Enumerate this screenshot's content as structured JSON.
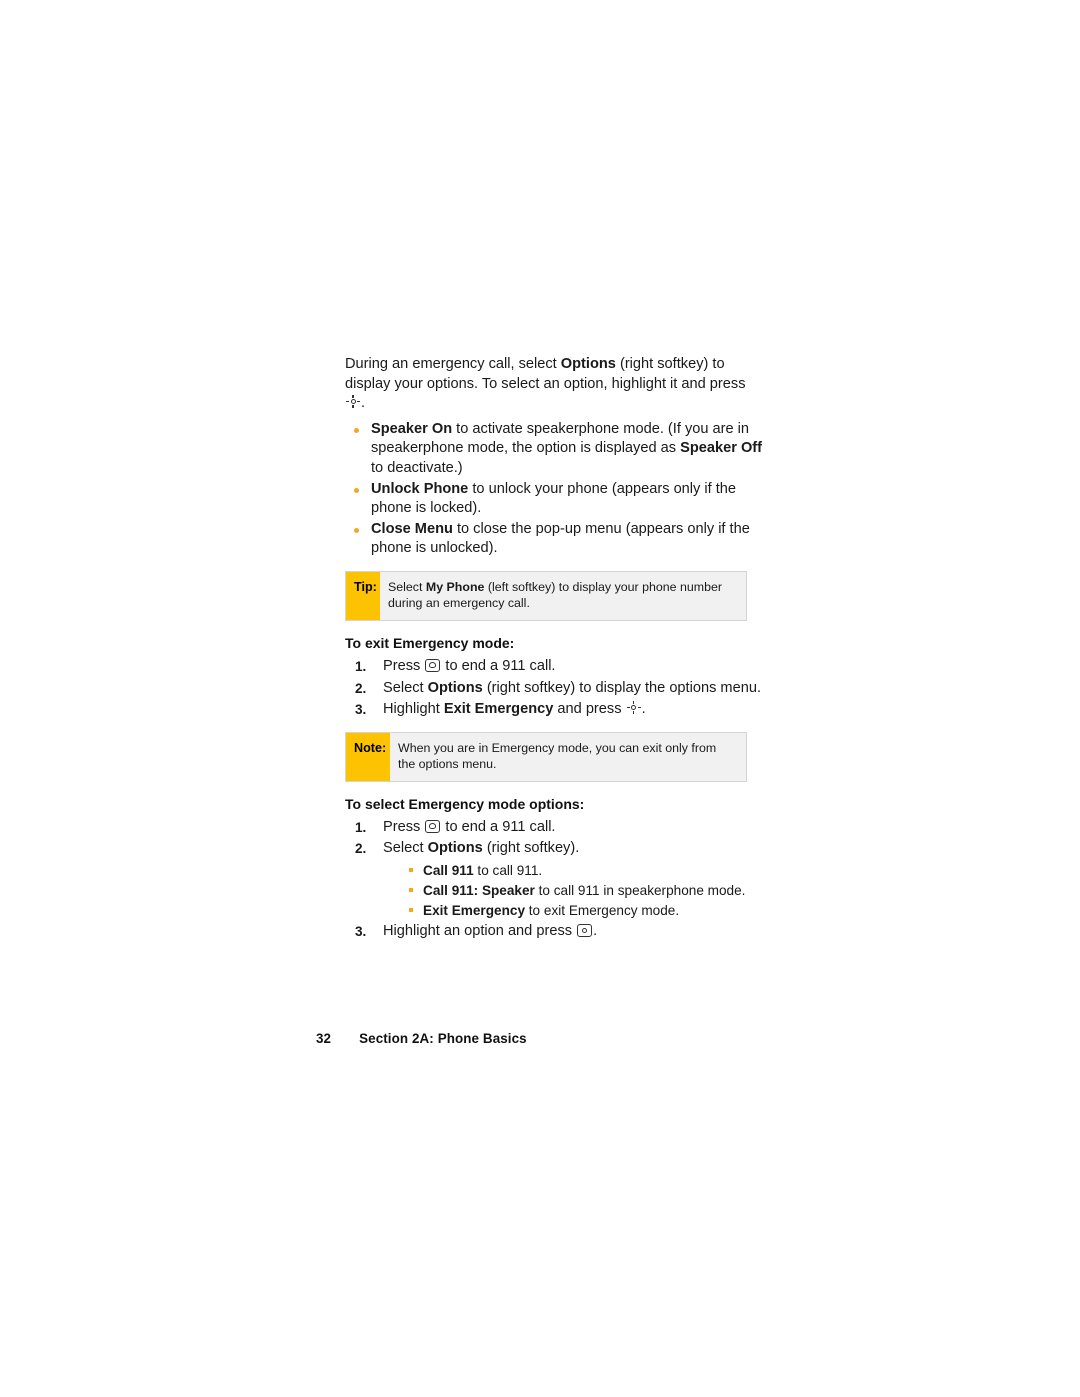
{
  "intro": {
    "line1_a": "During an emergency call, select ",
    "line1_b": "Options",
    "line1_c": " (right softkey) to display your options. To select an option, highlight it and press ",
    "line1_d": "."
  },
  "options_bullets": [
    {
      "bold1": "Speaker On",
      "text1": " to activate speakerphone mode. (If you are in speakerphone mode, the option is displayed as ",
      "bold2": "Speaker Off",
      "text2": " to deactivate.)"
    },
    {
      "bold1": "Unlock Phone",
      "text1": " to unlock your phone (appears only if the phone is locked).",
      "bold2": "",
      "text2": ""
    },
    {
      "bold1": "Close Menu",
      "text1": " to close the pop-up menu (appears only if the phone is unlocked).",
      "bold2": "",
      "text2": ""
    }
  ],
  "tip_callout": {
    "label": "Tip:",
    "text_a": "Select ",
    "text_b": "My Phone",
    "text_c": " (left softkey) to display your phone number during an emergency call."
  },
  "exit_section": {
    "heading": "To exit Emergency mode:",
    "steps": [
      {
        "num": "1.",
        "a": "Press ",
        "icon": "end-key-icon",
        "b": " to end a 911 call.",
        "bold": "",
        "c": ""
      },
      {
        "num": "2.",
        "a": "Select ",
        "icon": "",
        "bold": "Options",
        "b": " (right softkey) to display the options menu.",
        "c": ""
      },
      {
        "num": "3.",
        "a": "Highlight ",
        "icon": "nav-key-icon",
        "bold": "Exit Emergency",
        "b": " and press ",
        "c": "."
      }
    ]
  },
  "note_callout": {
    "label": "Note:",
    "text": "When you are in Emergency mode, you can exit only from the options menu."
  },
  "select_section": {
    "heading": "To select Emergency mode options:",
    "steps": [
      {
        "num": "1.",
        "a": "Press ",
        "icon": "end-key-icon",
        "b": " to end a 911 call."
      },
      {
        "num": "2.",
        "a": "Select ",
        "bold": "Options",
        "b": " (right softkey)."
      },
      {
        "num": "3.",
        "a": "Highlight an option and press ",
        "icon": "ok-key-icon",
        "b": "."
      }
    ],
    "sub_bullets": [
      {
        "bold": "Call 911",
        "text": " to call 911."
      },
      {
        "bold": "Call 911: Speaker",
        "text": " to call 911 in speakerphone mode."
      },
      {
        "bold": "Exit Emergency",
        "text": " to exit Emergency mode."
      }
    ]
  },
  "footer": {
    "page_number": "32",
    "section_title": "Section 2A: Phone Basics"
  },
  "colors": {
    "accent_yellow": "#fdc300",
    "bullet_orange": "#f5a623",
    "callout_bg": "#f1f1f1",
    "callout_border": "#d4d4d4"
  }
}
